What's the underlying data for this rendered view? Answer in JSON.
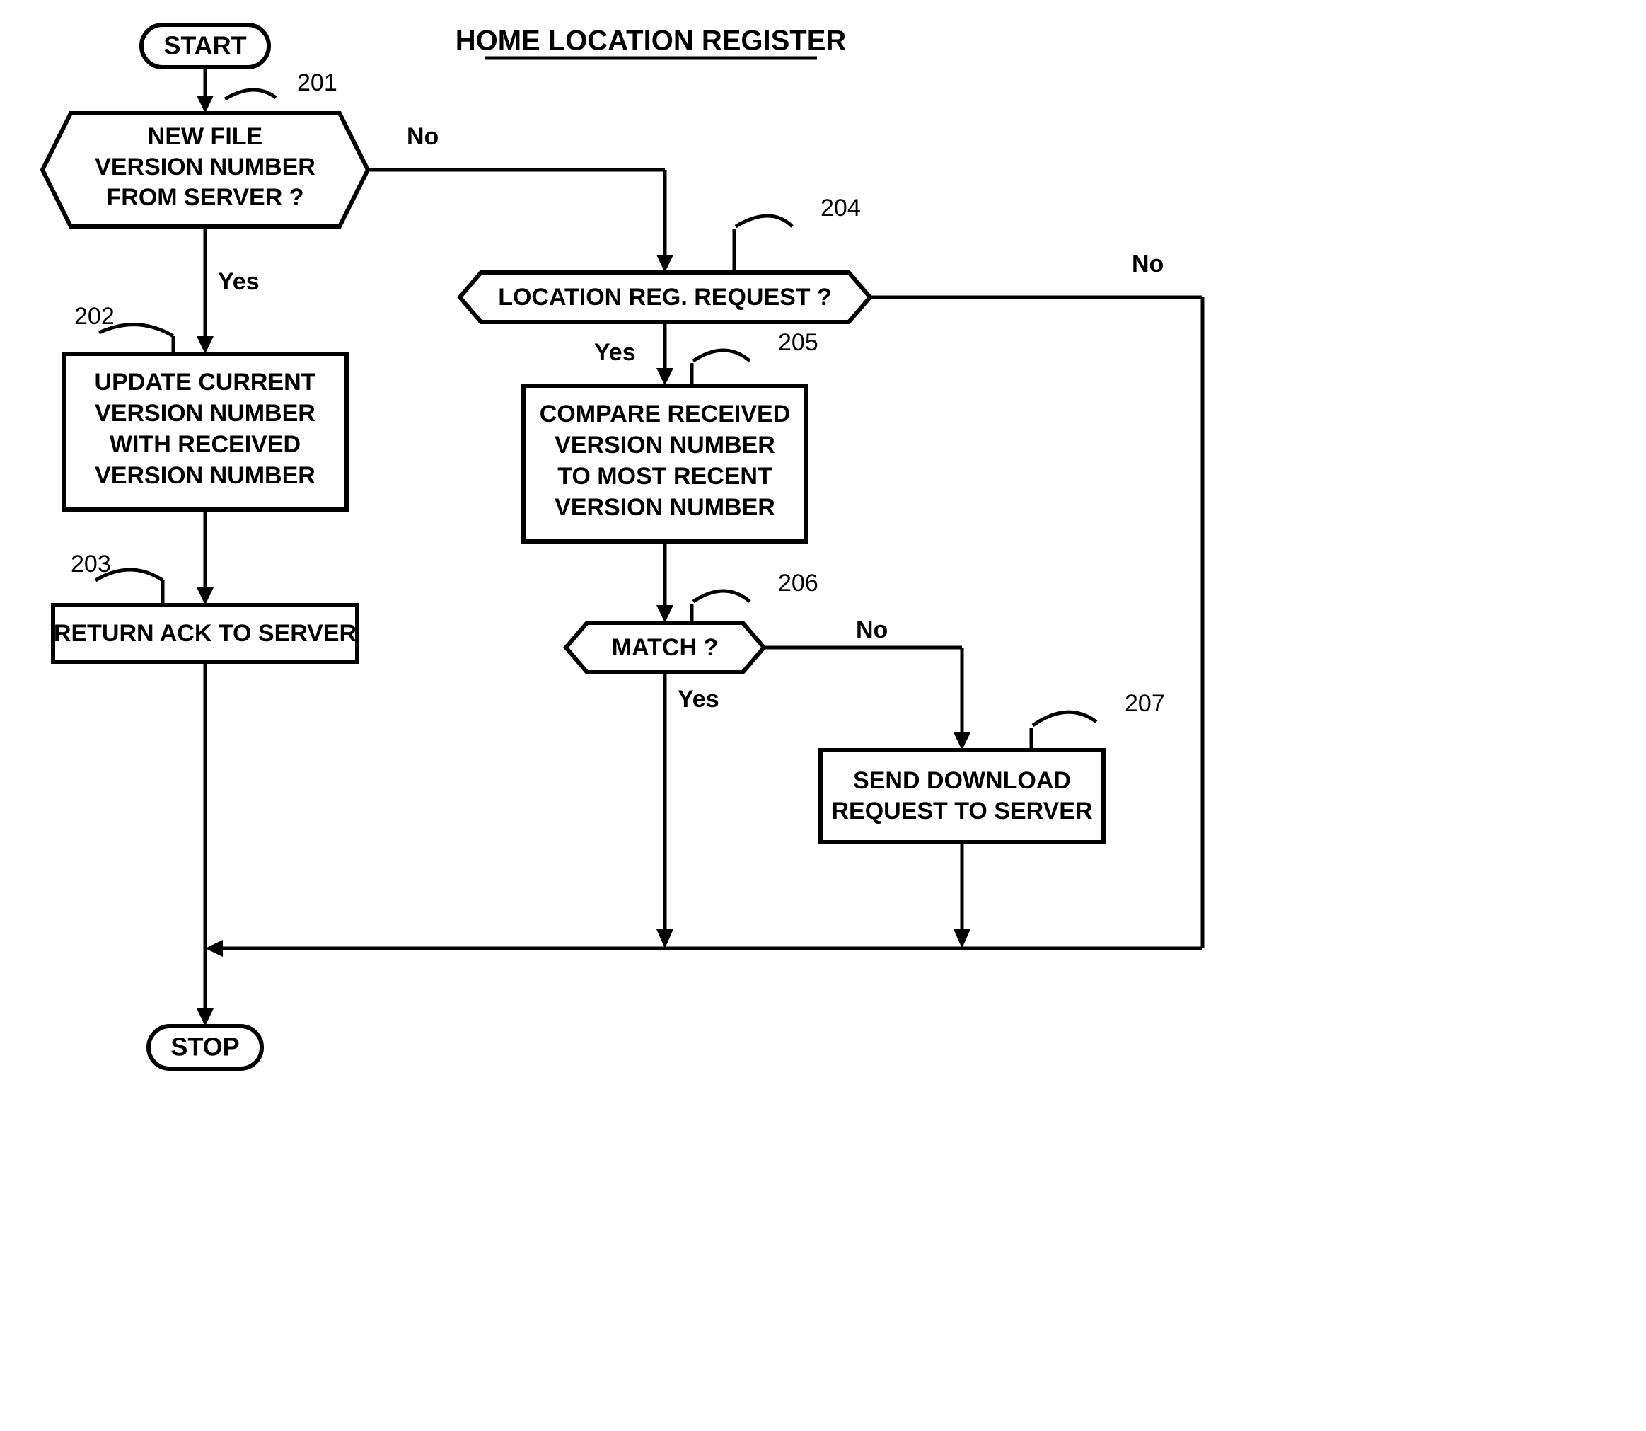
{
  "title": "HOME LOCATION REGISTER",
  "terminals": {
    "start": "START",
    "stop": "STOP"
  },
  "nodes": {
    "n201": {
      "ref": "201",
      "text": [
        "NEW FILE",
        "VERSION NUMBER",
        "FROM SERVER ?"
      ]
    },
    "n202": {
      "ref": "202",
      "text": [
        "UPDATE CURRENT",
        "VERSION NUMBER",
        "WITH RECEIVED",
        "VERSION NUMBER"
      ]
    },
    "n203": {
      "ref": "203",
      "text": [
        "RETURN ACK TO SERVER"
      ]
    },
    "n204": {
      "ref": "204",
      "text": [
        "LOCATION REG. REQUEST ?"
      ]
    },
    "n205": {
      "ref": "205",
      "text": [
        "COMPARE RECEIVED",
        "VERSION NUMBER",
        "TO MOST RECENT",
        "VERSION NUMBER"
      ]
    },
    "n206": {
      "ref": "206",
      "text": [
        "MATCH ?"
      ]
    },
    "n207": {
      "ref": "207",
      "text": [
        "SEND DOWNLOAD",
        "REQUEST TO SERVER"
      ]
    }
  },
  "labels": {
    "yes": "Yes",
    "no": "No"
  }
}
